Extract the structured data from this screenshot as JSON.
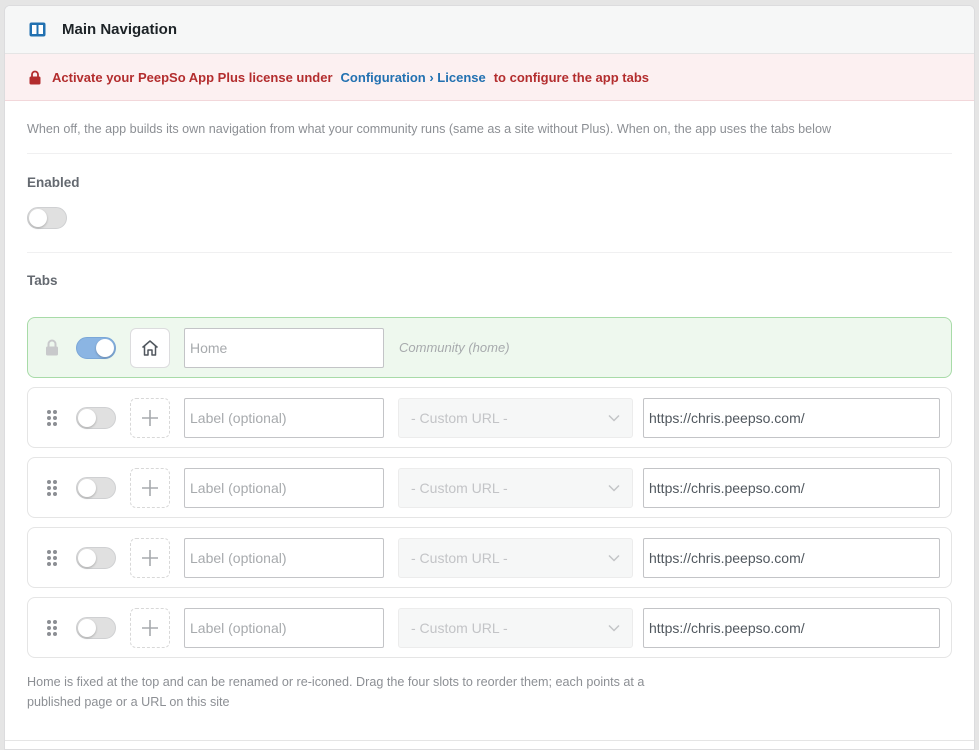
{
  "header": {
    "title": "Main Navigation",
    "icon": "columns-icon",
    "accent": "#2271b1"
  },
  "notice": {
    "prefix": "Activate your PeepSo App Plus license under",
    "link": "Configuration › License",
    "suffix": "to configure the app tabs",
    "color": "#b32d2e"
  },
  "description": "When off, the app builds its own navigation from what your community runs (same as a site without Plus). When on, the app uses the tabs below",
  "enabled": {
    "label": "Enabled",
    "on": false
  },
  "tabs": {
    "label": "Tabs",
    "home": {
      "enabled": true,
      "icon": "home-icon",
      "placeholder": "Home",
      "value": "",
      "destination": "Community (home)"
    },
    "slots": [
      {
        "enabled": false,
        "icon": "plus-icon",
        "placeholder": "Label (optional)",
        "select": "- Custom URL -",
        "url": "https://chris.peepso.com/"
      },
      {
        "enabled": false,
        "icon": "plus-icon",
        "placeholder": "Label (optional)",
        "select": "- Custom URL -",
        "url": "https://chris.peepso.com/"
      },
      {
        "enabled": false,
        "icon": "plus-icon",
        "placeholder": "Label (optional)",
        "select": "- Custom URL -",
        "url": "https://chris.peepso.com/"
      },
      {
        "enabled": false,
        "icon": "plus-icon",
        "placeholder": "Label (optional)",
        "select": "- Custom URL -",
        "url": "https://chris.peepso.com/"
      }
    ]
  },
  "help": "Home is fixed at the top and can be renamed or re-iconed. Drag the four slots to reorder them; each points at a published page or a URL on this site"
}
